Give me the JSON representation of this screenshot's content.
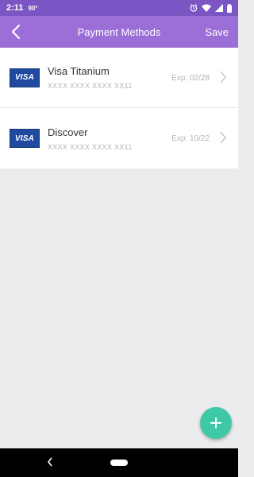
{
  "status_bar": {
    "time": "2:11",
    "temperature": "90°",
    "icons": [
      "alarm-icon",
      "wifi-icon",
      "signal-icon",
      "battery-icon"
    ]
  },
  "app_bar": {
    "back_icon": "back-arrow-icon",
    "title": "Payment Methods",
    "save_label": "Save",
    "color": "#9b6ed8"
  },
  "cards": [
    {
      "brand_label": "VISA",
      "name": "Visa Titanium",
      "number": "XXXX XXXX XXXX XX11",
      "expiry": "Exp: 02/28"
    },
    {
      "brand_label": "VISA",
      "name": "Discover",
      "number": "XXXX XXXX XXXX XX11",
      "expiry": "Exp: 10/22"
    }
  ],
  "fab": {
    "icon": "plus-icon",
    "color": "#3dc9a6"
  },
  "nav_bar": {
    "icons": [
      "nav-back-icon",
      "nav-home-icon"
    ]
  }
}
